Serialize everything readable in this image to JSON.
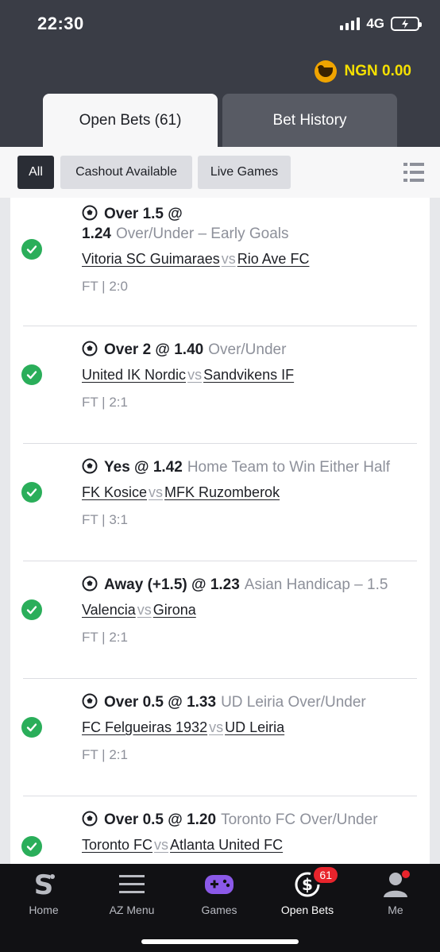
{
  "status_bar": {
    "time": "22:30",
    "network": "4G"
  },
  "balance": {
    "amount": "NGN 0.00"
  },
  "tabs": [
    {
      "label": "Open Bets (61)",
      "active": true
    },
    {
      "label": "Bet History",
      "active": false
    }
  ],
  "filters": [
    {
      "label": "All",
      "active": true
    },
    {
      "label": "Cashout Available",
      "active": false
    },
    {
      "label": "Live Games",
      "active": false
    }
  ],
  "bets": [
    {
      "pick": "Over 1.5 @",
      "pick2": "1.24",
      "market": "Over/Under  –  Early Goals",
      "home": "Vitoria SC Guimaraes",
      "vs": "vs",
      "away": "Rio Ave FC",
      "result": "FT | 2:0"
    },
    {
      "pick": "Over 2 @ 1.40",
      "market": "Over/Under",
      "home": "United IK Nordic",
      "vs": "vs",
      "away": "Sandvikens IF",
      "result": "FT | 2:1"
    },
    {
      "pick": "Yes @ 1.42",
      "market": "Home Team to Win Either Half",
      "home": "FK Kosice",
      "vs": "vs",
      "away": "MFK Ruzomberok",
      "result": "FT | 3:1"
    },
    {
      "pick": "Away (+1.5) @ 1.23",
      "market": "Asian Handicap  – 1.5",
      "home": "Valencia",
      "vs": "vs",
      "away": "Girona",
      "result": "FT | 2:1"
    },
    {
      "pick": "Over 0.5 @ 1.33",
      "market": "UD Leiria Over/Under",
      "home": "FC Felgueiras 1932",
      "vs": "vs",
      "away": "UD Leiria",
      "result": "FT | 2:1"
    },
    {
      "pick": "Over 0.5 @ 1.20",
      "market": "Toronto FC Over/Under",
      "home": "Toronto FC",
      "vs": "vs",
      "away": "Atlanta United FC",
      "result": ""
    }
  ],
  "bottom_nav": [
    {
      "label": "Home",
      "icon": "sporty-logo-icon"
    },
    {
      "label": "AZ Menu",
      "icon": "hamburger-menu-icon"
    },
    {
      "label": "Games",
      "icon": "gamepad-icon"
    },
    {
      "label": "Open Bets",
      "icon": "open-bets-icon",
      "badge": "61",
      "active": true
    },
    {
      "label": "Me",
      "icon": "user-icon"
    }
  ],
  "colors": {
    "accent": "#f5e000",
    "success": "#2aae5a",
    "badge": "#e8242c",
    "header": "#3a3d46"
  }
}
